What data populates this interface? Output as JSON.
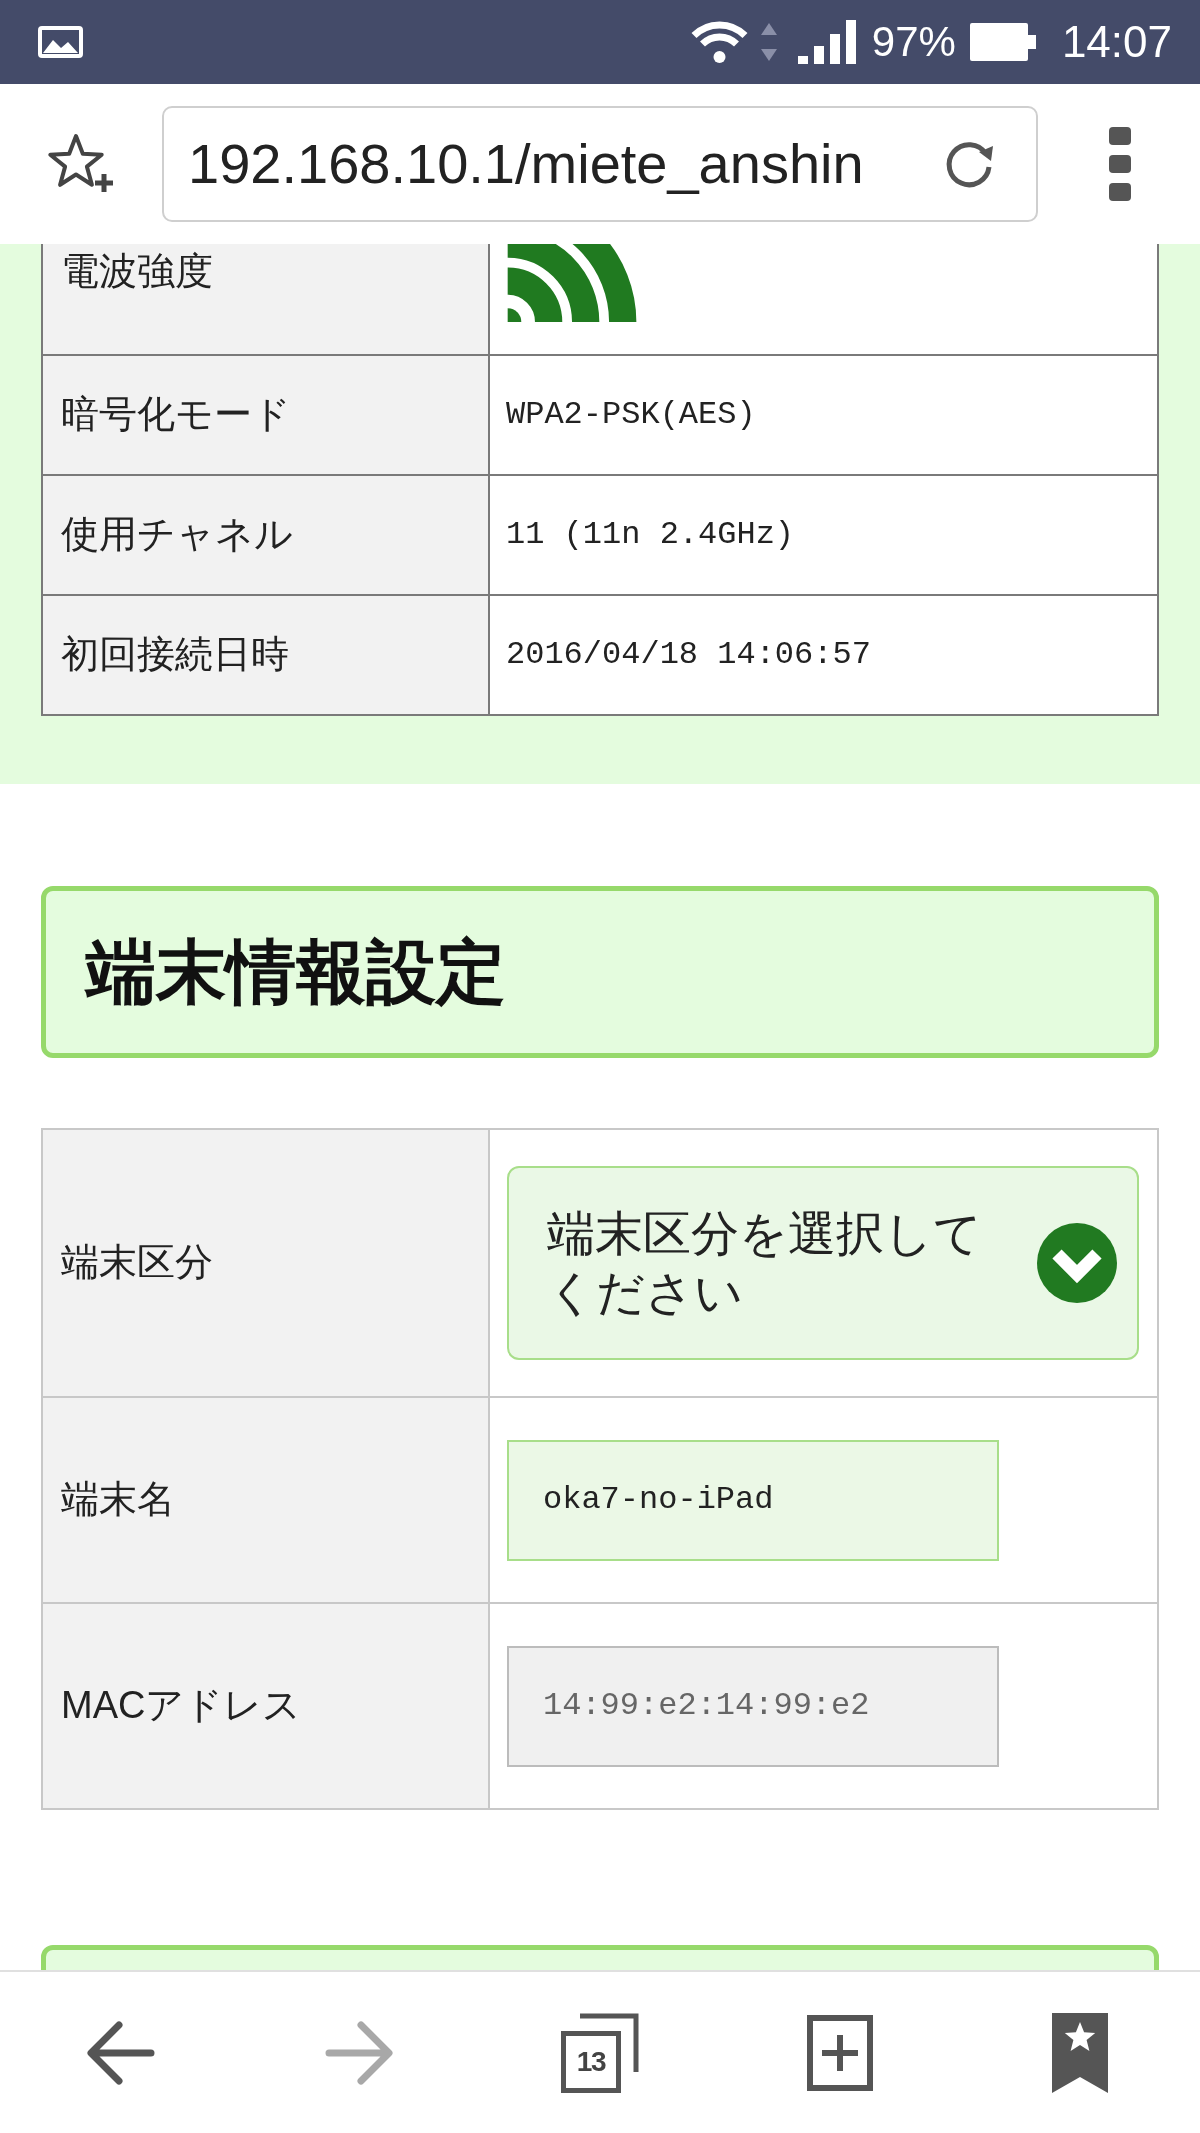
{
  "status_bar": {
    "battery": "97%",
    "time": "14:07"
  },
  "browser": {
    "url": "192.168.10.1/miete_anshin"
  },
  "connection_info": {
    "rows": [
      {
        "kind": "signal",
        "label": "電波強度"
      },
      {
        "kind": "text",
        "label": "暗号化モード",
        "value": "WPA2-PSK(AES)"
      },
      {
        "kind": "text",
        "label": "使用チャネル",
        "value": "11 (11n 2.4GHz)"
      },
      {
        "kind": "text",
        "label": "初回接続日時",
        "value": "2016/04/18 14:06:57"
      }
    ]
  },
  "device_settings": {
    "title": "端末情報設定",
    "rows": [
      {
        "kind": "select",
        "label": "端末区分",
        "value": "端末区分を選択してください"
      },
      {
        "kind": "input",
        "label": "端末名",
        "value": "oka7-no-iPad",
        "disabled": false
      },
      {
        "kind": "input",
        "label": "MACアドレス",
        "value": "14:99:e2:14:99:e2",
        "disabled": true
      }
    ]
  },
  "nav_bar": {
    "back_enabled": true,
    "forward_enabled": false,
    "tab_count": "13"
  }
}
